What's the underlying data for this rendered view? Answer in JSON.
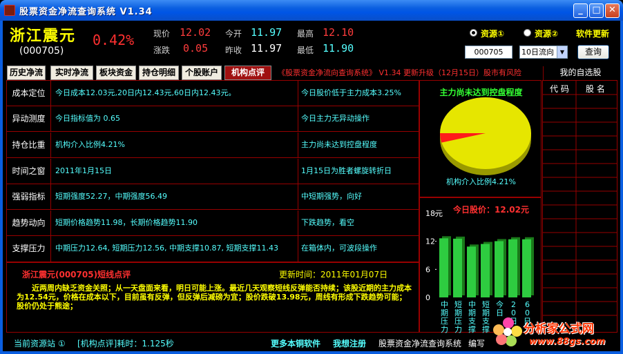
{
  "window": {
    "title": "股票资金净流查询系统  V1.34"
  },
  "header": {
    "stock_name": "浙江震元",
    "stock_code": "(000705)",
    "change_pct": "0.42%",
    "quote": [
      {
        "label": "现价",
        "value": "12.02",
        "color": "red"
      },
      {
        "label": "今开",
        "value": "11.97",
        "color": "cyan"
      },
      {
        "label": "最高",
        "value": "12.10",
        "color": "red"
      },
      {
        "label": "涨跌",
        "value": "0.05",
        "color": "red"
      },
      {
        "label": "昨收",
        "value": "11.97",
        "color": "white"
      },
      {
        "label": "最低",
        "value": "11.90",
        "color": "cyan"
      }
    ]
  },
  "controls": {
    "source1": "资源①",
    "source2": "资源②",
    "update_label": "软件更新",
    "code_value": "000705",
    "period_value": "10日流向",
    "query_label": "查询"
  },
  "tabs": [
    "历史净流",
    "实时净流",
    "板块资金",
    "持仓明细",
    "个股账户",
    "机构点评"
  ],
  "marquee": "《股票资金净流向查询系统》 V1.34  更新升级（12月15日）股市有风险",
  "watchlist": {
    "title": "我的自选股",
    "col_code": "代 码",
    "col_name": "股 名"
  },
  "rows": [
    {
      "label": "成本定位",
      "detail": "今日成本12.03元,20日内12.43元,60日内12.43元。",
      "judge": "今日股价低于主力成本3.25%"
    },
    {
      "label": "异动测度",
      "detail": "今日指标值为 0.65",
      "judge": "今日主力无异动操作"
    },
    {
      "label": "持仓比重",
      "detail": "机构介入比例4.21%",
      "judge": "主力尚未达到控盘程度"
    },
    {
      "label": "时间之窗",
      "detail": "2011年1月15日",
      "judge": "1月15日为胜者螺旋转折日"
    },
    {
      "label": "强弱指标",
      "detail": "短期强度52.27，中期强度56.49",
      "judge": "中短期强势，向好"
    },
    {
      "label": "趋势动向",
      "detail": "短期价格趋势11.98，长期价格趋势11.90",
      "judge": "下跌趋势，看空"
    },
    {
      "label": "支撑压力",
      "detail": "中期压力12.64, 短期压力12.56, 中期支撑10.87, 短期支撑11.43",
      "judge": "在箱体内，可波段操作"
    }
  ],
  "pie": {
    "title": "主力尚未达到控盘程度",
    "caption": "机构介入比例4.21%",
    "share": 0.0421,
    "colors": {
      "main": "#e6e600",
      "slice": "#ff1a1a"
    }
  },
  "chart_data": {
    "type": "bar",
    "title": "今日股价：12.02元",
    "ylabel": "元",
    "ylim": [
      0,
      18
    ],
    "yticks": [
      "18",
      "12",
      "6",
      "0"
    ],
    "categories": [
      "中期压力",
      "短期压力",
      "中期支撑",
      "短期支撑",
      "今日",
      "20日",
      "60日"
    ],
    "values": [
      12.64,
      12.56,
      10.87,
      11.43,
      12.03,
      12.43,
      12.43
    ],
    "color": "#2ecc40"
  },
  "comment": {
    "title": "浙江震元(000705)短线点评",
    "time": "更新时间：2011年01月07日",
    "body": "近两周内缺乏资金关照；从一天盘面来看，明日可能上涨。最近几天观察短线反弹能否持续；该股近期的主力成本为12.54元，价格在成本以下，目前虽有反弹，但反弹后减磅为宜；股价跌破13.98元，周线有形成下跌趋势可能；股价仍处于熊途；"
  },
  "status": {
    "source": "当前资源站 ①",
    "timing": "[机构点评]耗时：1.125秒",
    "more": "更多本铜软件",
    "register": "我想注册",
    "app": "股票资金净流查询系统",
    "edit": "编写"
  },
  "watermark": {
    "brand": "分析家公式网",
    "url": "www.88gs.com"
  }
}
